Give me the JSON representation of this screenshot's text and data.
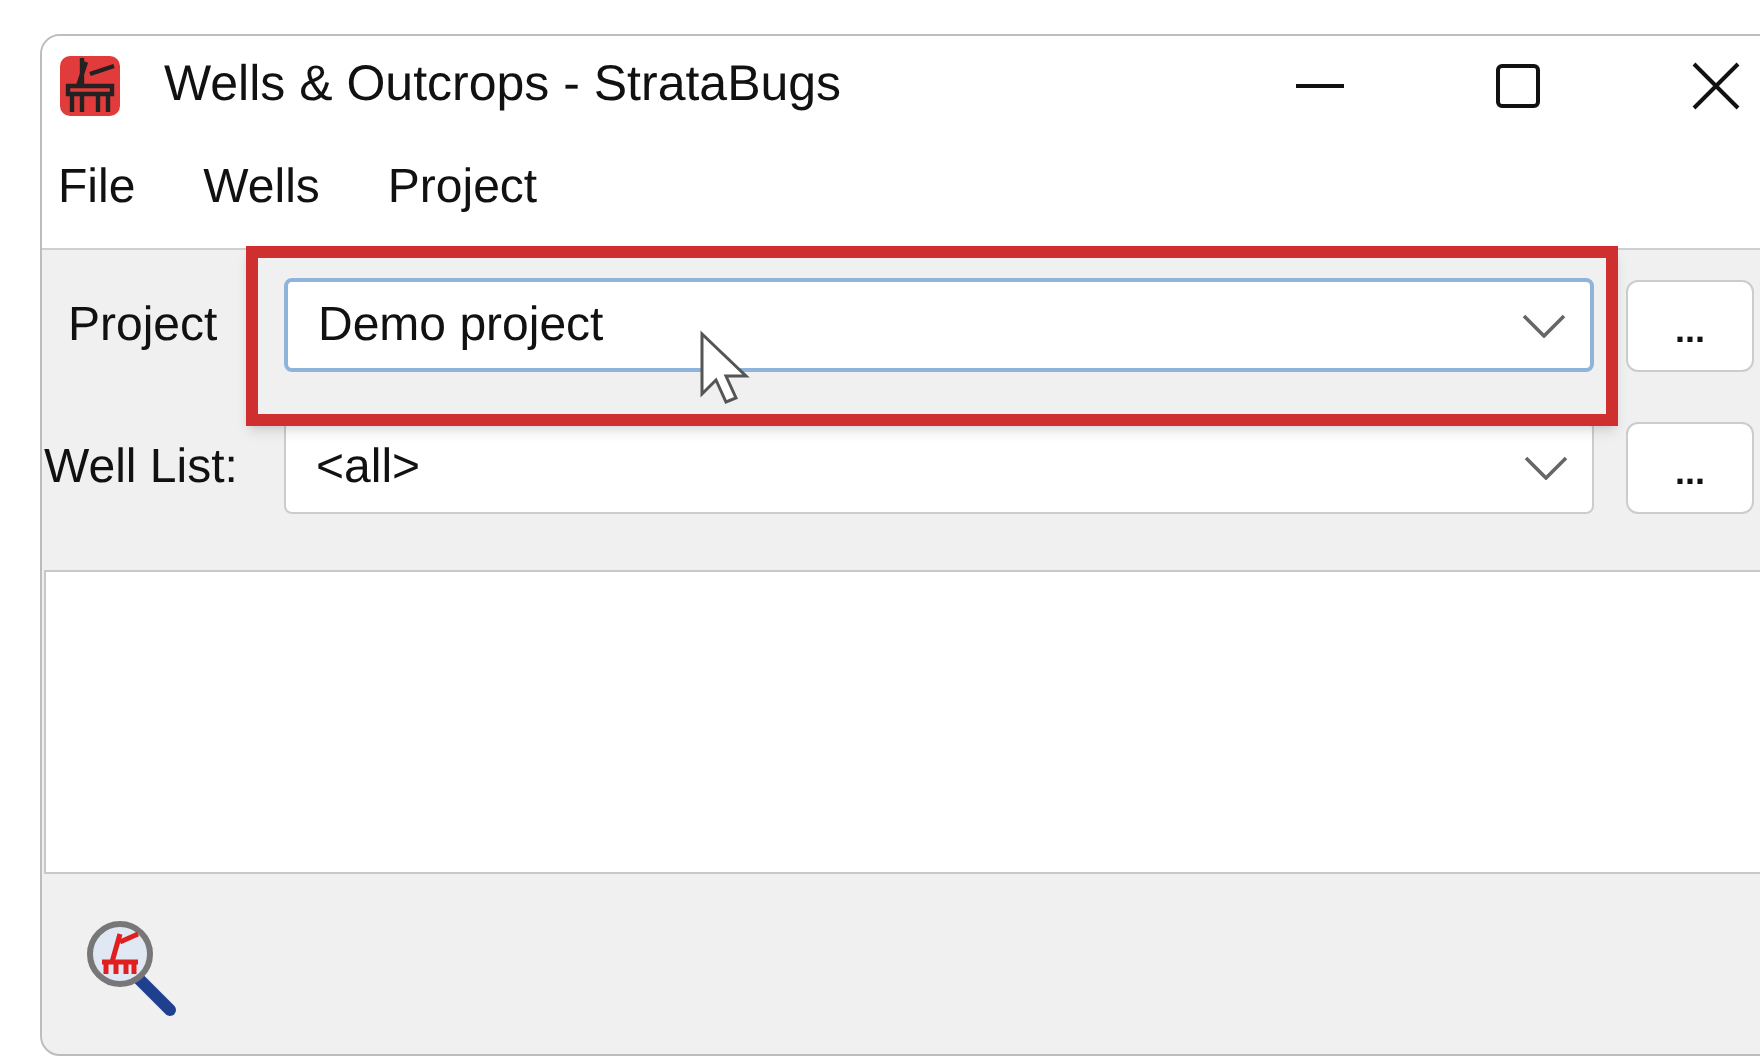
{
  "window": {
    "title": "Wells & Outcrops - StrataBugs"
  },
  "menu": [
    {
      "label": "File"
    },
    {
      "label": "Wells"
    },
    {
      "label": "Project"
    }
  ],
  "fields": [
    {
      "label": "Project",
      "value": "Demo project",
      "focused": true,
      "highlighted": true,
      "button": "..."
    },
    {
      "label": "Well List:",
      "value": "<all>",
      "focused": false,
      "highlighted": false,
      "button": "..."
    }
  ]
}
